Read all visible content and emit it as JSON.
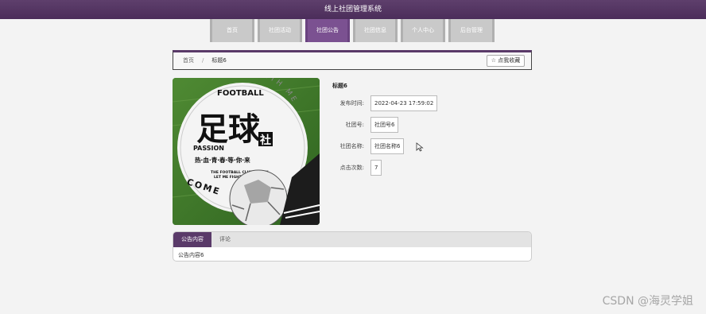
{
  "app": {
    "title": "线上社团管理系统"
  },
  "nav": {
    "items": [
      {
        "label": "首页",
        "active": false
      },
      {
        "label": "社团活动",
        "active": false
      },
      {
        "label": "社团公告",
        "active": true
      },
      {
        "label": "社团信息",
        "active": false
      },
      {
        "label": "个人中心",
        "active": false
      },
      {
        "label": "后台管理",
        "active": false
      }
    ]
  },
  "breadcrumb": {
    "home": "首页",
    "separator": "/",
    "current": "标题6"
  },
  "favorite_button": {
    "label": "☆ 点我收藏"
  },
  "cover": {
    "text_football": "FOOTBALL",
    "text_big": "足球",
    "text_she": "社",
    "text_passion": "PASSION",
    "text_slogan": "热·血·青·春·等·你·来",
    "text_club_line1": "THE FOOTBALL CLUB IS NEW",
    "text_club_line2": "LET ME FIGHT TOGETHER",
    "text_arc": "COME WITH ME",
    "text_come": "COME"
  },
  "detail": {
    "title": "标题6",
    "fields": [
      {
        "label": "发布时间:",
        "value": "2022-04-23 17:59:02"
      },
      {
        "label": "社团号:",
        "value": "社团号6"
      },
      {
        "label": "社团名称:",
        "value": "社团名称6"
      },
      {
        "label": "点击次数:",
        "value": "7"
      }
    ]
  },
  "tabs": {
    "items": [
      {
        "label": "公告内容",
        "active": true
      },
      {
        "label": "评论",
        "active": false
      }
    ],
    "content": "公告内容6"
  },
  "watermark": "CSDN @海灵学姐"
}
